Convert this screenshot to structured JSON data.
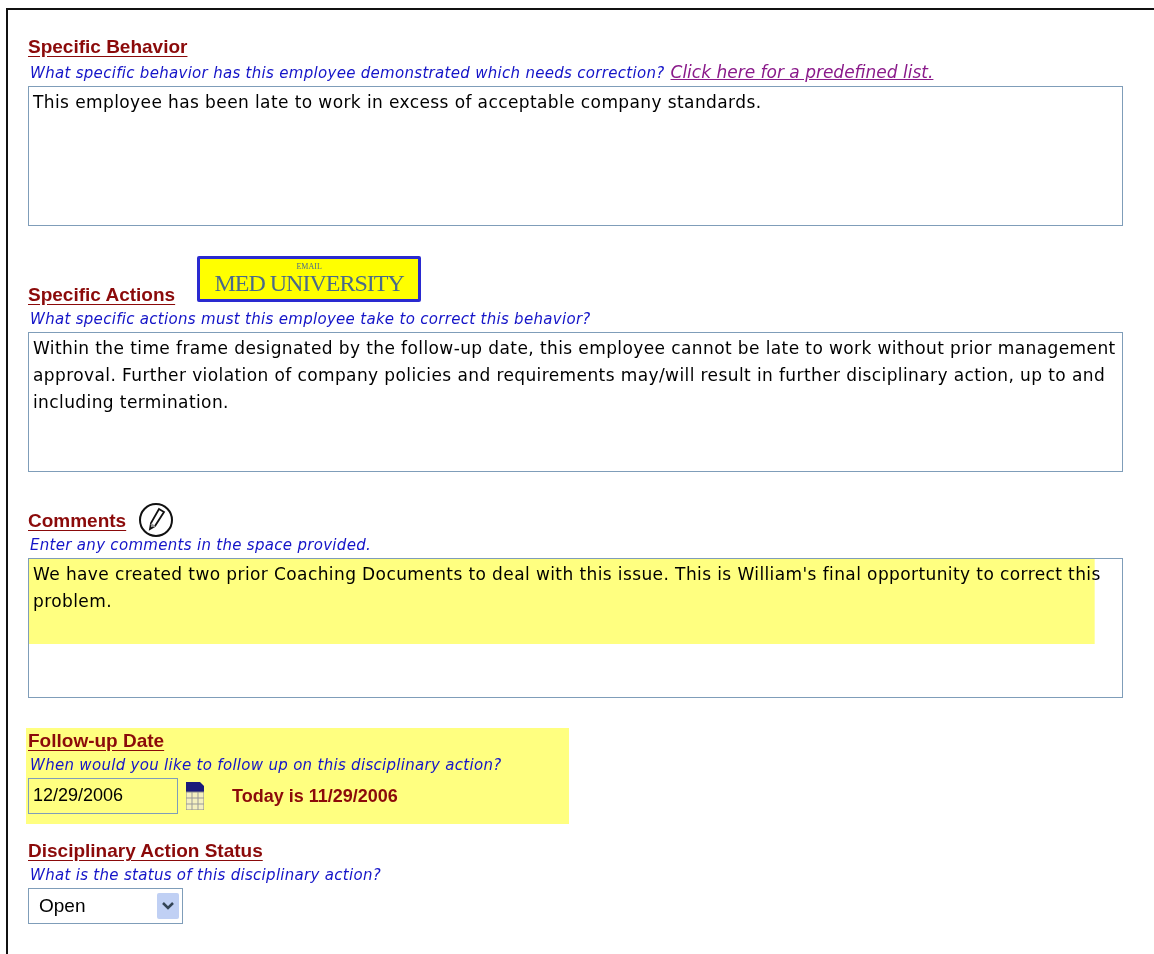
{
  "sections": [
    {
      "kind": "textarea",
      "title": "Specific Behavior",
      "hint": "What specific behavior has this employee demonstrated which needs correction?",
      "link": "Click here for a predefined list.",
      "value": "This employee has been late to work in excess of acceptable company standards.",
      "highlighted": false
    },
    {
      "kind": "textarea",
      "title": "Specific Actions",
      "logo": {
        "small": "EMAIL",
        "big": "MED UNIVERSITY"
      },
      "hint": "What specific actions must this employee take to correct this behavior?",
      "value": "Within the time frame designated by the follow-up date,  this employee cannot be late to work without prior management approval. Further violation of company policies and requirements may/will result in further disciplinary action, up to and including termination.",
      "highlighted": false
    },
    {
      "kind": "textarea",
      "title": "Comments",
      "pencil": true,
      "hint": "Enter any comments in the space provided.",
      "value": "We have created two prior Coaching Documents to deal with this issue.  This is William's final opportunity to correct this problem.",
      "highlighted": true
    },
    {
      "kind": "date",
      "title": "Follow-up Date",
      "hint": "When would you like to follow up on this disciplinary action?",
      "value": "12/29/2006",
      "today": "Today is 11/29/2006",
      "highlighted": true
    },
    {
      "kind": "select",
      "title": "Disciplinary Action Status",
      "hint": "What is the status of this disciplinary action?",
      "value": "Open",
      "highlighted": false
    }
  ]
}
